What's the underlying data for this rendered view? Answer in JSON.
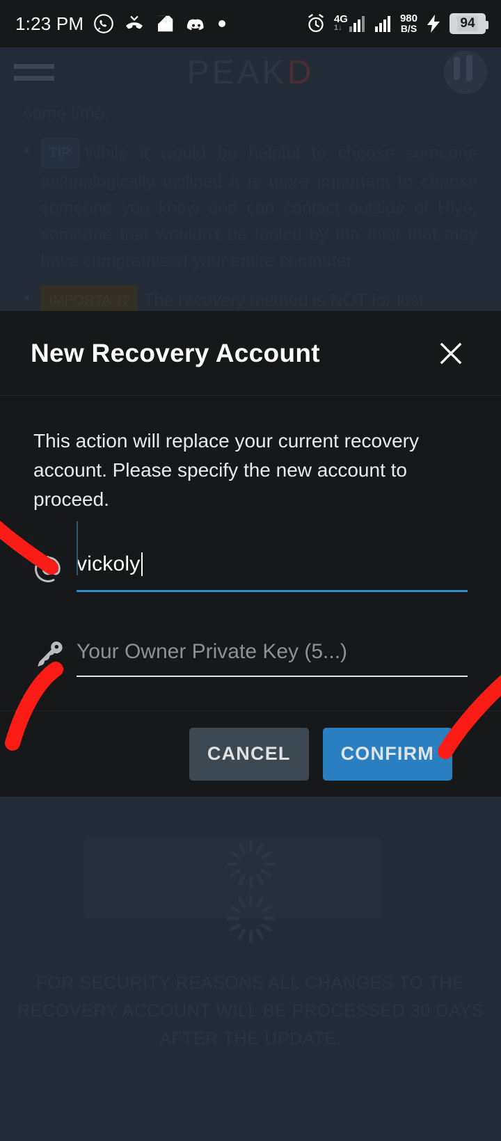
{
  "status_bar": {
    "time": "1:23 PM",
    "left_icons": [
      "whatsapp-icon",
      "missed-call-icon",
      "note-icon",
      "discord-icon",
      "dot-icon"
    ],
    "right_icons": [
      "alarm-icon",
      "signal-4g-icon",
      "signal-icon",
      "charging-bolt-icon"
    ],
    "network_type": "4G",
    "network_sub": "1↓",
    "net_speed_value": "980",
    "net_speed_unit": "B/S",
    "battery_percent": "94"
  },
  "app_background": {
    "brand_main": "PEAK",
    "brand_accent": "D",
    "menu_icon": "hamburger-icon",
    "line_first": "same time.",
    "tip_tag": "TIP",
    "tip_text": "While it would be helpful to choose someone technologically inclined it is more important to choose someone you know and can contact outside of Hive, someone that wouldn't be fooled by the thief that may have compromised your entire computer.",
    "important_tag": "IMPORTANT",
    "important_text": "The recovery method is NOT for lost",
    "footer_notice": "FOR SECURITY REASONS ALL CHANGES TO THE RECOVERY ACCOUNT WILL BE PROCESSED 30 DAYS AFTER THE UPDATE."
  },
  "dialog": {
    "title": "New Recovery Account",
    "close_icon": "close-icon",
    "description": "This action will replace your current recovery account. Please specify the new account to proceed.",
    "fields": [
      {
        "icon": "at-sign-icon",
        "value": "vickoly",
        "placeholder": "",
        "focused": true
      },
      {
        "icon": "key-icon",
        "value": "",
        "placeholder": "Your Owner Private Key (5...)",
        "focused": false
      }
    ],
    "cancel_label": "CANCEL",
    "confirm_label": "CONFIRM",
    "colors": {
      "confirm_bg": "#2a7fc0",
      "cancel_bg": "#3c4952",
      "focus_underline": "#2c8fc9",
      "dialog_bg": "#16181a",
      "annotation_red": "#fc1c16"
    }
  }
}
